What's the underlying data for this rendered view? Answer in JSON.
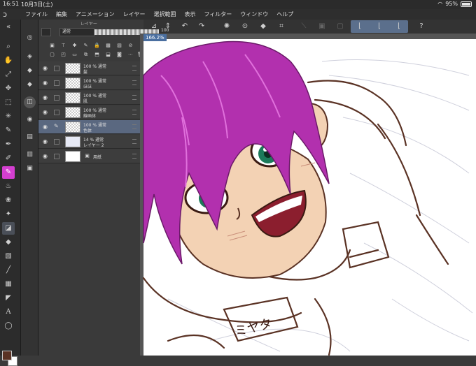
{
  "status": {
    "time": "16:51",
    "date": "10月3日(土)",
    "battery": "95%"
  },
  "menu": [
    "ファイル",
    "編集",
    "アニメーション",
    "レイヤー",
    "選択範囲",
    "表示",
    "フィルター",
    "ウィンドウ",
    "ヘルプ"
  ],
  "layer_panel": {
    "title": "レイヤー",
    "blend_mode": "通常",
    "opacity": "100",
    "layers": [
      {
        "mode": "100 % 通常",
        "name": "髪"
      },
      {
        "mode": "100 % 通常",
        "name": "ほほ"
      },
      {
        "mode": "100 % 通常",
        "name": "肌"
      },
      {
        "mode": "100 % 通常",
        "name": "線画体"
      },
      {
        "mode": "100 % 通常",
        "name": "色体"
      },
      {
        "mode": "14 % 通常",
        "name": "レイヤー 2"
      },
      {
        "mode": "",
        "name": "用紙"
      }
    ]
  },
  "canvas": {
    "zoom": "166.2%",
    "nameplate": "ミヤタ"
  },
  "colors": {
    "main": "#5a3224",
    "sub": "#ffffff",
    "accent": "#d43fd0",
    "selected_layer": "#5a6880"
  }
}
